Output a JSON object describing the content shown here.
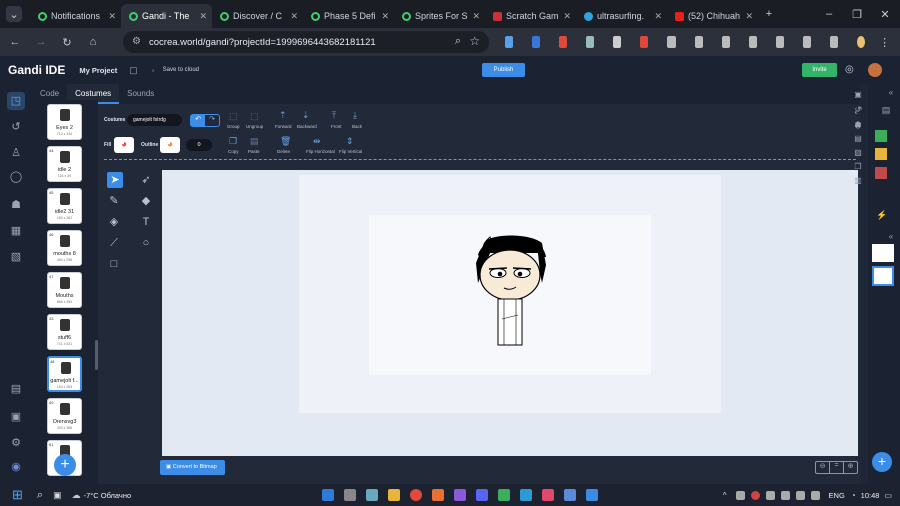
{
  "browser": {
    "tabs": [
      {
        "label": "Notifications",
        "icon": "gandi-icon"
      },
      {
        "label": "Gandi - The",
        "icon": "gandi-icon",
        "active": true
      },
      {
        "label": "Discover / C",
        "icon": "gandi-icon"
      },
      {
        "label": "Phase 5 Defi",
        "icon": "gandi-icon"
      },
      {
        "label": "Sprites For S",
        "icon": "gandi-icon"
      },
      {
        "label": "Scratch Gam",
        "icon": "scratch-icon"
      },
      {
        "label": "ultrasurfing.",
        "icon": "edge-icon"
      },
      {
        "label": "(52) Chihuah",
        "icon": "youtube-icon"
      }
    ],
    "url": "cocrea.world/gandi?projectId=1999696443682181121"
  },
  "appbar": {
    "logo": "Gandi IDE",
    "project": "My Project",
    "save": "Save to cloud",
    "publish": "Publish",
    "invite": "Invite"
  },
  "editor_tabs": [
    "Code",
    "Costumes",
    "Sounds"
  ],
  "costumes": [
    {
      "num": "",
      "name": "Eyes 2",
      "size": "713 x 444"
    },
    {
      "num": "44",
      "name": "idle 2",
      "size": "116 x 39"
    },
    {
      "num": "45",
      "name": "idle2 31",
      "size": "180 x 262"
    },
    {
      "num": "46",
      "name": "mouths 8",
      "size": "484 x 298"
    },
    {
      "num": "47",
      "name": "Mouths",
      "size": "886 x 350"
    },
    {
      "num": "43",
      "name": "stuff6",
      "size": "741 x 531"
    },
    {
      "num": "48",
      "name": "gamejolt f...",
      "size": "154 x 263",
      "selected": true
    },
    {
      "num": "49",
      "name": "Orensvg3",
      "size": "343 x 388"
    },
    {
      "num": "61",
      "name": "C...",
      "size": ""
    }
  ],
  "paint": {
    "costume_label": "Costume",
    "costume_name": "gamejolt fstrdg",
    "group": "Group",
    "ungroup": "Ungroup",
    "forward": "Forward",
    "backward": "Backward",
    "front": "Front",
    "back": "Back",
    "fill": "Fill",
    "outline": "Outline",
    "outline_value": "0",
    "copy": "Copy",
    "paste": "Paste",
    "delete": "Delete",
    "flip_h": "Flip Horizontal",
    "flip_v": "Flip Vertical",
    "convert": "Convert to Bitmap"
  },
  "taskbar": {
    "weather": "-7°C Облачно",
    "lang": "ENG",
    "time": "10:48"
  },
  "colors": {
    "accent": "#3b8de8",
    "invite": "#34b36a",
    "publish": "#3b8de8"
  }
}
